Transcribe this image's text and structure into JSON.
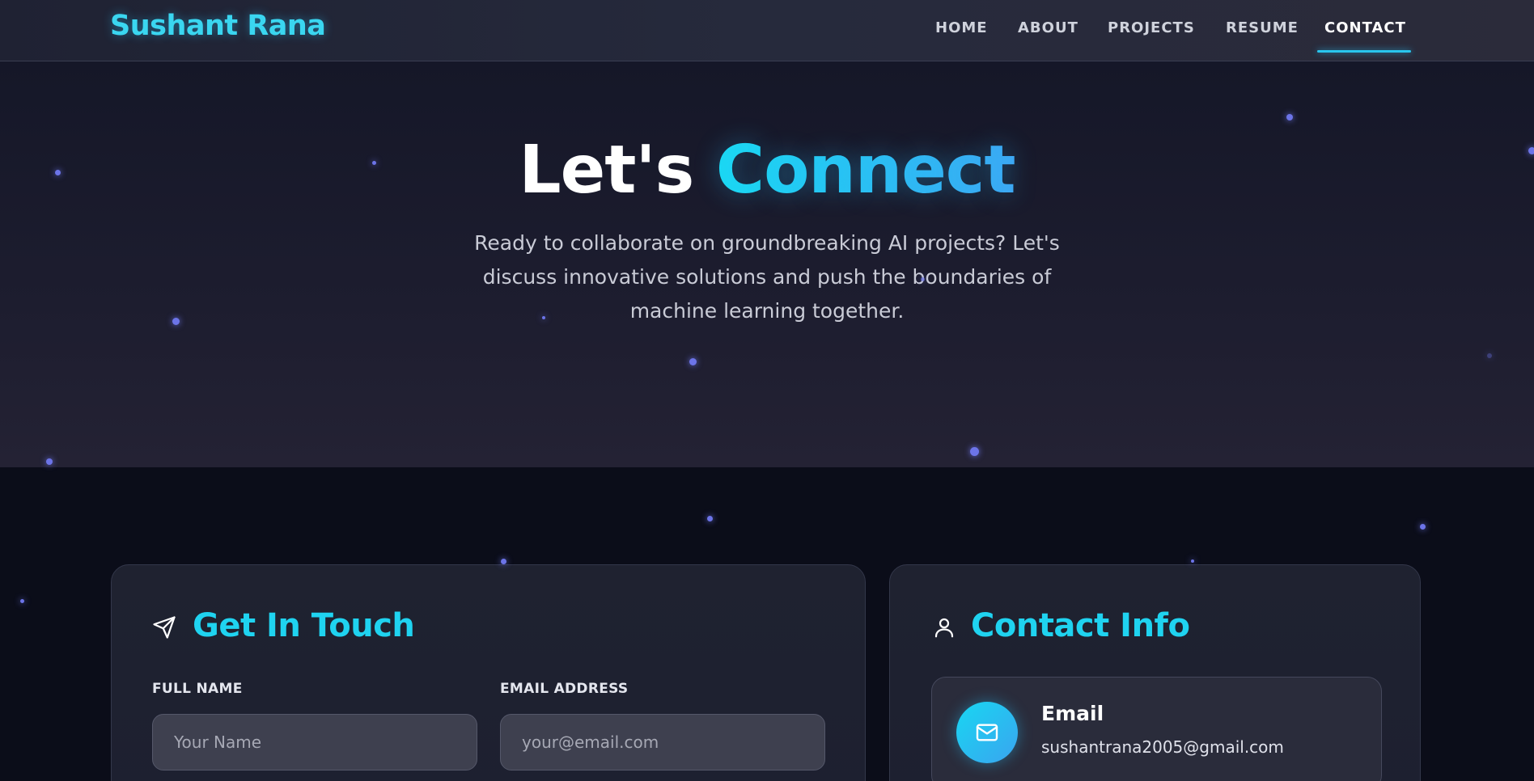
{
  "nav": {
    "logo": "Sushant Rana",
    "links": [
      {
        "label": "HOME"
      },
      {
        "label": "ABOUT"
      },
      {
        "label": "PROJECTS"
      },
      {
        "label": "RESUME"
      },
      {
        "label": "CONTACT"
      }
    ],
    "active": "CONTACT"
  },
  "hero": {
    "title_part1": "Let's",
    "title_part2": "Connect",
    "subtitle": "Ready to collaborate on groundbreaking AI projects? Let's discuss innovative solutions and push the boundaries of machine learning together."
  },
  "form_card": {
    "title": "Get In Touch",
    "icon": "send-icon",
    "fields": [
      {
        "label": "FULL NAME",
        "placeholder": "Your Name",
        "value": ""
      },
      {
        "label": "EMAIL ADDRESS",
        "placeholder": "your@email.com",
        "value": ""
      }
    ]
  },
  "info_card": {
    "title": "Contact Info",
    "icon": "user-icon",
    "items": [
      {
        "icon": "mail-icon",
        "label": "Email",
        "value": "sushantrana2005@gmail.com"
      }
    ]
  },
  "colors": {
    "accent": "#1fd3f0",
    "accent_end": "#3fa6f2",
    "background": "#0b0d19",
    "particle": "#6c74e8"
  }
}
